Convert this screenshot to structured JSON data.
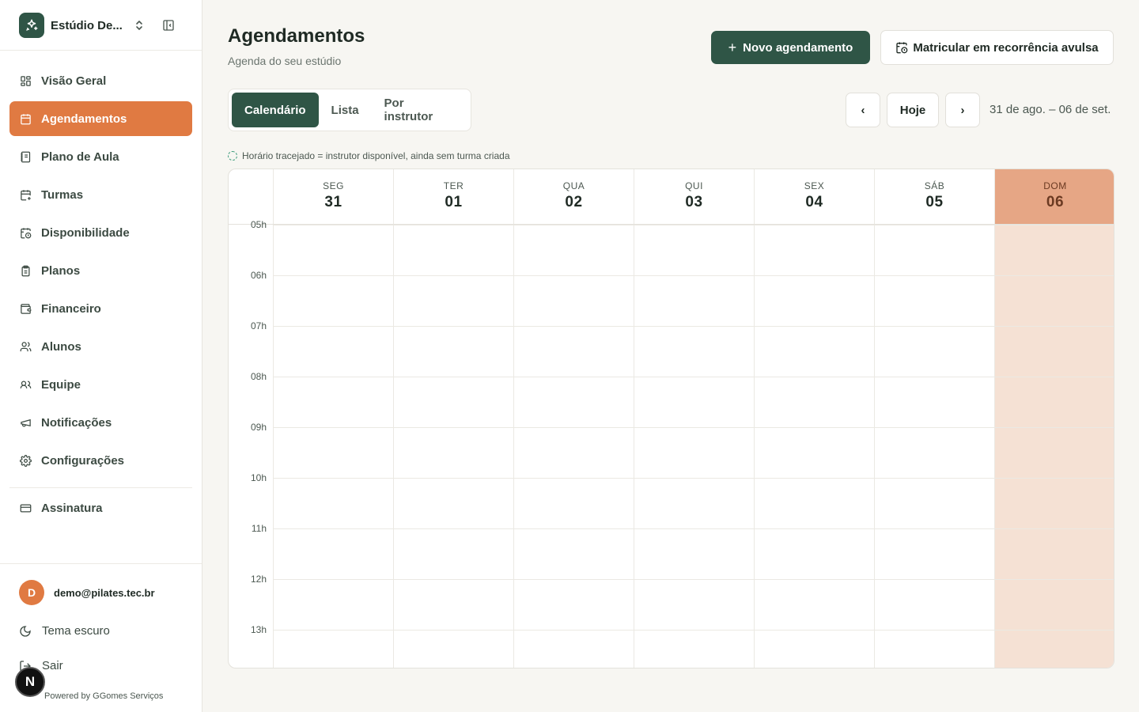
{
  "sidebar": {
    "brand_name": "Estúdio De...",
    "items": [
      {
        "label": "Visão Geral",
        "icon": "dashboard-icon"
      },
      {
        "label": "Agendamentos",
        "icon": "calendar-icon",
        "active": true
      },
      {
        "label": "Plano de Aula",
        "icon": "notebook-icon"
      },
      {
        "label": "Turmas",
        "icon": "calendar-plus-icon"
      },
      {
        "label": "Disponibilidade",
        "icon": "calendar-clock-icon"
      },
      {
        "label": "Planos",
        "icon": "clipboard-icon"
      },
      {
        "label": "Financeiro",
        "icon": "wallet-icon"
      },
      {
        "label": "Alunos",
        "icon": "users-icon"
      },
      {
        "label": "Equipe",
        "icon": "team-icon"
      },
      {
        "label": "Notificações",
        "icon": "megaphone-icon"
      },
      {
        "label": "Configurações",
        "icon": "gear-icon"
      }
    ],
    "subscription_label": "Assinatura",
    "user": {
      "initial": "D",
      "email": "demo@pilates.tec.br"
    },
    "theme_label": "Tema escuro",
    "logout_label": "Sair",
    "badge_letter": "N",
    "powered_by": "Powered by GGomes Serviços",
    "accent_color": "#e07a42",
    "brand_color": "#2f5546"
  },
  "header": {
    "title": "Agendamentos",
    "subtitle": "Agenda do seu estúdio",
    "new_button": "Novo agendamento",
    "enroll_button": "Matricular em recorrência avulsa"
  },
  "tabs": [
    {
      "label": "Calendário",
      "active": true
    },
    {
      "label": "Lista"
    },
    {
      "label": "Por instrutor"
    }
  ],
  "calendar_nav": {
    "prev": "‹",
    "today": "Hoje",
    "next": "›",
    "range": "31 de ago. – 06 de set."
  },
  "legend": "Horário tracejado = instrutor disponível, ainda sem turma criada",
  "calendar": {
    "days": [
      {
        "dow": "SEG",
        "num": "31"
      },
      {
        "dow": "TER",
        "num": "01"
      },
      {
        "dow": "QUA",
        "num": "02"
      },
      {
        "dow": "QUI",
        "num": "03"
      },
      {
        "dow": "SEX",
        "num": "04"
      },
      {
        "dow": "SÁB",
        "num": "05"
      },
      {
        "dow": "DOM",
        "num": "06",
        "today": true
      }
    ],
    "hours": [
      "05h",
      "06h",
      "07h",
      "08h",
      "09h",
      "10h",
      "11h",
      "12h",
      "13h"
    ],
    "today_header_color": "#e6a685",
    "today_column_color": "#f5e1d4"
  }
}
